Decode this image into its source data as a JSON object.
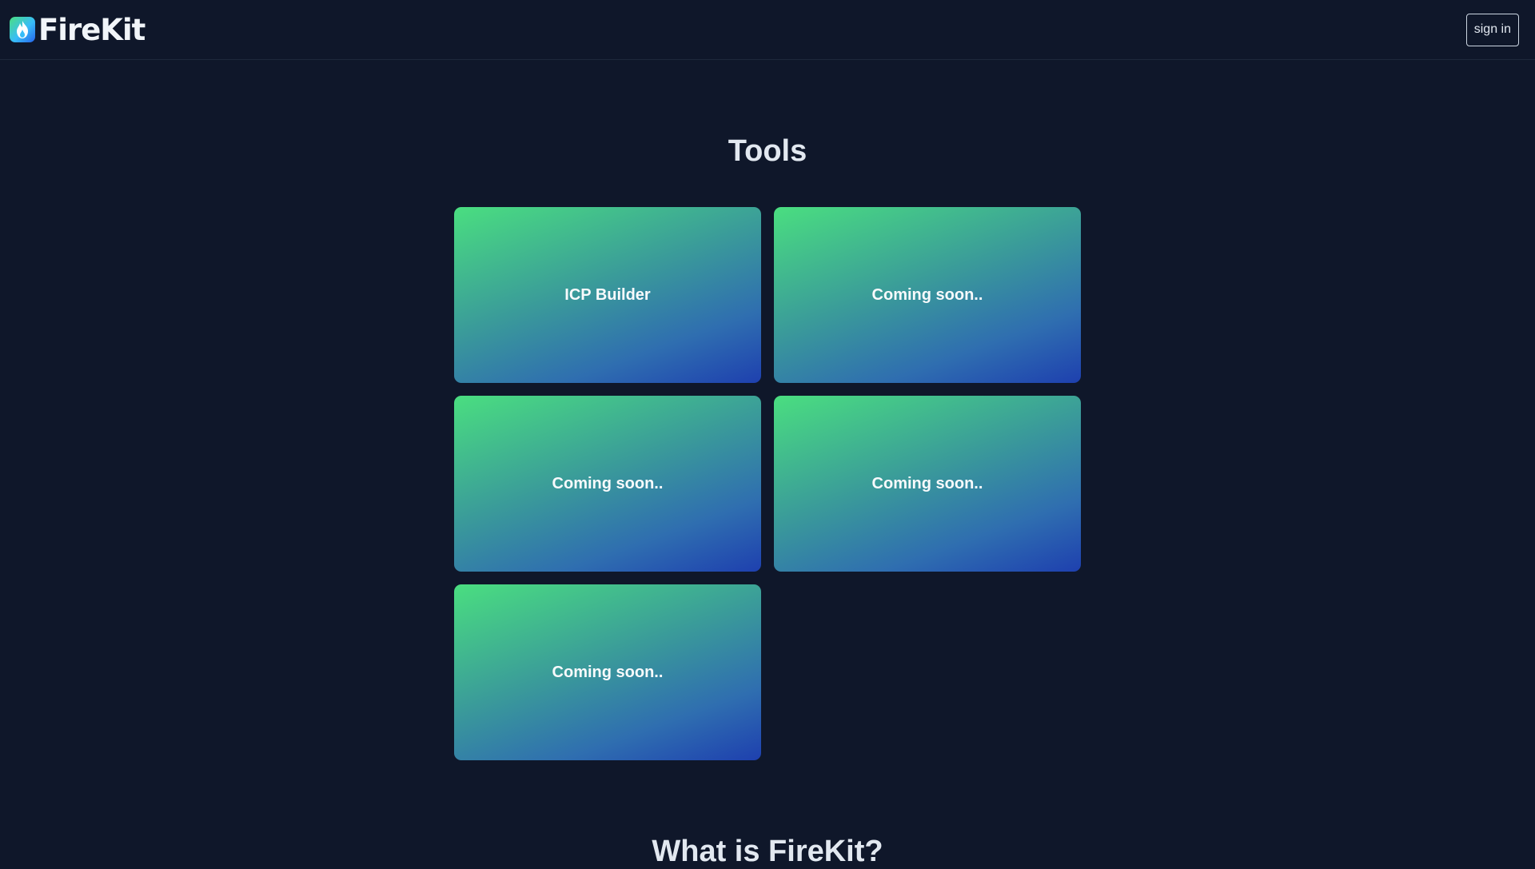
{
  "header": {
    "brand": "FireKit",
    "logo_icon": "flame-icon",
    "signin_label": "sign in"
  },
  "tools": {
    "title": "Tools",
    "cards": [
      {
        "label": "ICP Builder"
      },
      {
        "label": "Coming soon.."
      },
      {
        "label": "Coming soon.."
      },
      {
        "label": "Coming soon.."
      },
      {
        "label": "Coming soon.."
      }
    ]
  },
  "about": {
    "title": "What is FireKit?"
  },
  "colors": {
    "background": "#0f172a",
    "card_gradient_start": "#4ade80",
    "card_gradient_end": "#1e40af",
    "text": "#e2e8f0"
  }
}
